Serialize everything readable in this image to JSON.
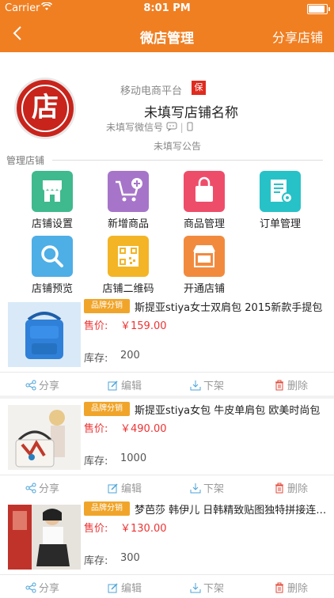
{
  "status": {
    "carrier": "Carrier",
    "time": "8:01 PM"
  },
  "nav": {
    "back": "‹",
    "title": "微店管理",
    "share": "分享店铺"
  },
  "shop": {
    "logo_char": "店",
    "platform": "移动电商平台",
    "badge": "保",
    "name": "未填写店铺名称",
    "wechat": "未填写微信号",
    "notice": "未填写公告"
  },
  "mgmt": {
    "label": "管理店铺",
    "tools": [
      {
        "label": "店铺设置",
        "icon": "store-icon",
        "color": "#3fba8e"
      },
      {
        "label": "新增商品",
        "icon": "cart-add-icon",
        "color": "#a675c9"
      },
      {
        "label": "商品管理",
        "icon": "bag-icon",
        "color": "#ee4d6a"
      },
      {
        "label": "订单管理",
        "icon": "order-icon",
        "color": "#27c2c7"
      },
      {
        "label": "店铺预览",
        "icon": "search-icon",
        "color": "#4eaee6"
      },
      {
        "label": "店铺二维码",
        "icon": "qrcode-icon",
        "color": "#f3b526"
      },
      {
        "label": "开通店铺",
        "icon": "shop-open-icon",
        "color": "#f28a3e"
      }
    ]
  },
  "products": [
    {
      "tag": "品牌分销",
      "name": "斯提亚stiya女士双肩包 2015新款手提包",
      "price_label": "售价:",
      "price": "￥159.00",
      "stock_label": "库存:",
      "stock": "200"
    },
    {
      "tag": "品牌分销",
      "name": "斯提亚stiya女包 牛皮单肩包 欧美时尚包",
      "price_label": "售价:",
      "price": "￥490.00",
      "stock_label": "库存:",
      "stock": "1000"
    },
    {
      "tag": "品牌分销",
      "name": "梦芭莎 韩伊儿 日韩精致贴图独特拼接连衣裙",
      "price_label": "售价:",
      "price": "￥130.00",
      "stock_label": "库存:",
      "stock": "300"
    }
  ],
  "actions": {
    "share": "分享",
    "edit": "编辑",
    "off": "下架",
    "delete": "删除"
  },
  "colors": {
    "brand": "#f07f22",
    "price": "#e33333",
    "tag": "#f0a52a"
  }
}
